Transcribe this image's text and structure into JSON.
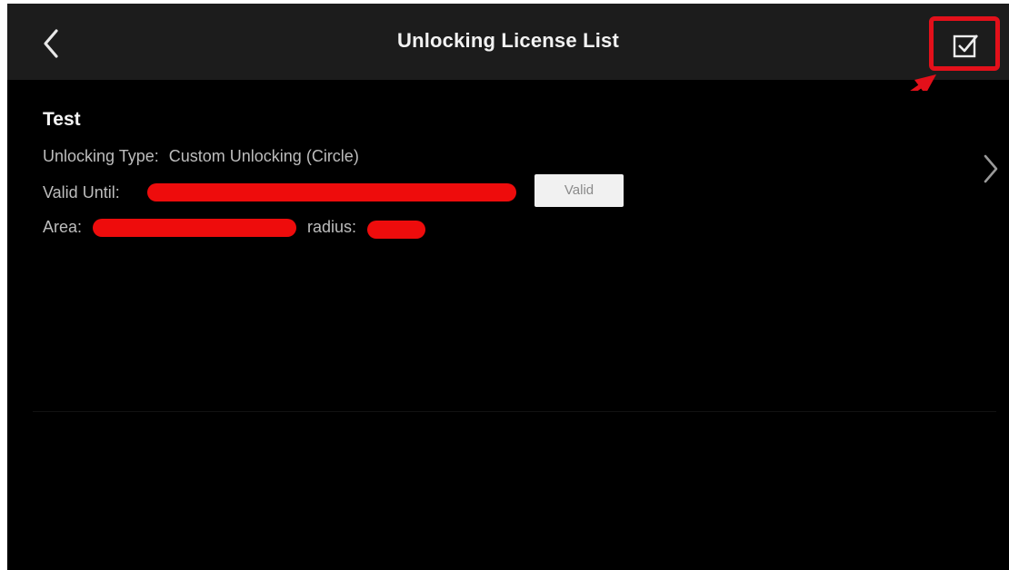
{
  "header": {
    "title": "Unlocking License List",
    "back_icon": "chevron-left-icon",
    "select_icon": "checkbox-checked-icon",
    "highlight_color": "#e3101a"
  },
  "licenses": [
    {
      "name": "Test",
      "type_label": "Unlocking Type:",
      "type_value": "Custom Unlocking (Circle)",
      "valid_until_label": "Valid Until:",
      "status": "Valid",
      "area_label": "Area:",
      "radius_label": "radius:"
    }
  ],
  "colors": {
    "background": "#000000",
    "header_bg": "#1c1c1c",
    "redaction": "#ee0c0c"
  }
}
